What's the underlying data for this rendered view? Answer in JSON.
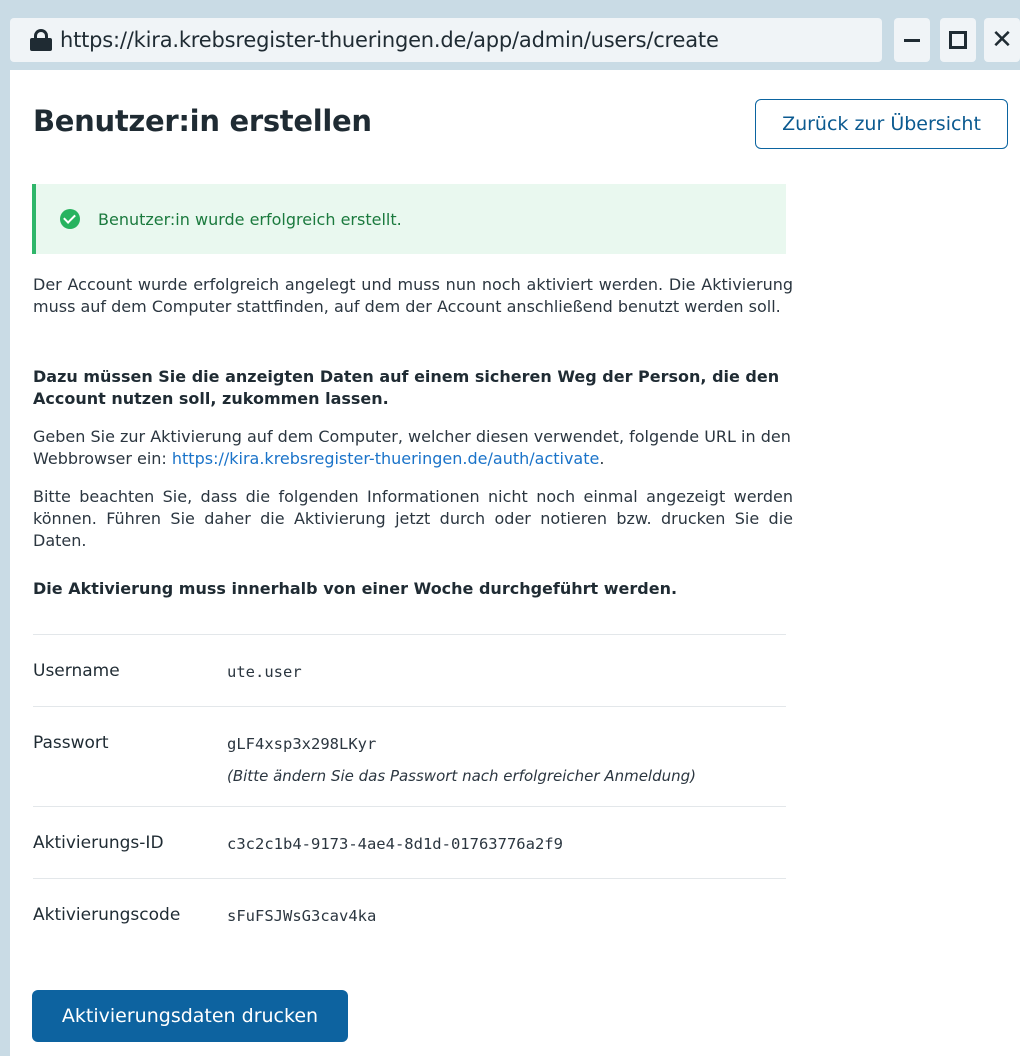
{
  "window": {
    "url": "https://kira.krebsregister-thueringen.de/app/admin/users/create",
    "minimize_symbol": "–",
    "close_symbol": "✕"
  },
  "header": {
    "title": "Benutzer:in erstellen",
    "back_button_label": "Zurück zur Übersicht"
  },
  "alert": {
    "message": "Benutzer:in wurde erfolgreich erstellt.",
    "icon": "check-circle-icon",
    "color": "#2fb66a"
  },
  "paragraphs": {
    "p1": "Der Account wurde erfolgreich angelegt und muss nun noch aktiviert werden. Die Aktivierung muss auf dem Computer stattfinden, auf dem der Account anschließend benutzt werden soll.",
    "p2": "Dazu müssen Sie die anzeigten Daten auf einem sicheren Weg der Person, die den Account nutzen soll, zukommen lassen.",
    "p3_prefix": "Geben Sie zur Aktivierung auf dem Computer, welcher diesen verwendet, folgende URL in den Webbrowser ein: ",
    "p3_link": "https://kira.krebsregister-thueringen.de/auth/activate",
    "p3_suffix": ".",
    "p4": "Bitte beachten Sie, dass die folgenden Informationen nicht noch einmal angezeigt werden können. Führen Sie daher die Aktivierung jetzt durch oder notieren bzw. drucken Sie die Daten.",
    "p5": "Die Aktivierung muss innerhalb von einer Woche durchgeführt werden."
  },
  "details": {
    "username_label": "Username",
    "username_value": "ute.user",
    "password_label": "Passwort",
    "password_value": "gLF4xsp3x298LKyr",
    "password_note": "(Bitte ändern Sie das Passwort nach erfolgreicher Anmeldung)",
    "activation_id_label": "Aktivierungs-ID",
    "activation_id_value": "c3c2c1b4-9173-4ae4-8d1d-01763776a2f9",
    "activation_code_label": "Aktivierungscode",
    "activation_code_value": "sFuFSJWsG3cav4ka"
  },
  "actions": {
    "print_button_label": "Aktivierungsdaten drucken"
  },
  "colors": {
    "primary": "#0d63a0",
    "link": "#1a73c9",
    "success_bg": "#e9f8ef",
    "frame": "#c9dbe5"
  }
}
